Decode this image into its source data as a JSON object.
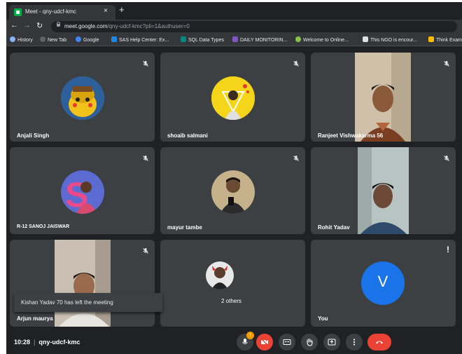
{
  "browser": {
    "tab_title": "Meet - qny-udcf-kmc",
    "tab_close": "×",
    "new_tab": "+",
    "url_main": "meet.google.com",
    "url_rest": "/qny-udcf-kmc?pli=1&authuser=0",
    "bookmarks": [
      "History",
      "New Tab",
      "Google",
      "SAS Help Center: Ex...",
      "SQL Data Types",
      "DAILY MONITORIN...",
      "Welcome to Online...",
      "This NGO is encour...",
      "Think Exam"
    ]
  },
  "participants": [
    {
      "name": "Anjali Singh"
    },
    {
      "name": "shoaib salmani"
    },
    {
      "name": "Ranjeet Vishwakarma 56"
    },
    {
      "name": "R-12 SANOJ JAISWAR"
    },
    {
      "name": "mayur tambe"
    },
    {
      "name": "Rohit Yadav"
    },
    {
      "name": "Arjun maurya"
    },
    {
      "name": "2 others"
    },
    {
      "name": "You",
      "initial": "V"
    }
  ],
  "toast": "Kishan Yadav 70 has left the meeting",
  "alert_mark": "!",
  "mic_badge": "!",
  "meeting": {
    "time": "10:28",
    "separator": "|",
    "code": "qny-udcf-kmc"
  },
  "colors": {
    "meet_bg": "#202124",
    "tile_bg": "#3c4043",
    "accent_red": "#ea4335",
    "you_avatar": "#1a73e8"
  }
}
